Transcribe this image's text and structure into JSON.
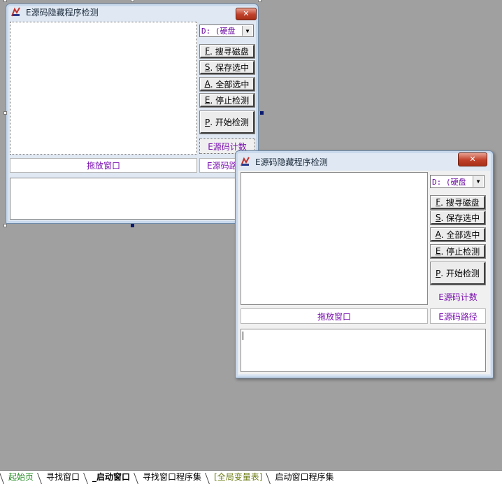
{
  "design_window": {
    "title": "E源码隐藏程序检测",
    "close_glyph": "✕",
    "drive_combo": "D: (硬盘",
    "buttons": {
      "search": {
        "hotkey": "F",
        "label": ". 搜寻磁盘"
      },
      "save": {
        "hotkey": "S",
        "label": ". 保存选中"
      },
      "select_all": {
        "hotkey": "A",
        "label": ". 全部选中"
      },
      "stop": {
        "hotkey": "E",
        "label": ". 停止检测"
      },
      "start": {
        "hotkey": "P",
        "label": ". 开始检测"
      }
    },
    "count_label": "E源码计数",
    "path_label": "E源码路",
    "drop_label": "拖放窗口"
  },
  "run_window": {
    "title": "E源码隐藏程序检测",
    "close_glyph": "✕",
    "drive_combo": "D: (硬盘",
    "buttons": {
      "search": {
        "hotkey": "F",
        "label": ". 搜寻磁盘"
      },
      "save": {
        "hotkey": "S",
        "label": ". 保存选中"
      },
      "select_all": {
        "hotkey": "A",
        "label": ". 全部选中"
      },
      "stop": {
        "hotkey": "E",
        "label": ". 停止检测"
      },
      "start": {
        "hotkey": "P",
        "label": ". 开始检测"
      }
    },
    "count_label": "E源码计数",
    "path_label": "E源码路径",
    "drop_label": "拖放窗口"
  },
  "tabs": [
    {
      "label": "起始页",
      "color": "#1e8a1e"
    },
    {
      "label": "寻找窗口",
      "color": "#000000"
    },
    {
      "label": "_启动窗口",
      "color": "#000000",
      "active": true
    },
    {
      "label": "寻找窗口程序集",
      "color": "#000000"
    },
    {
      "label": "[全局变量表]",
      "color": "#6a7a10"
    },
    {
      "label": "启动窗口程序集",
      "color": "#000000"
    }
  ]
}
